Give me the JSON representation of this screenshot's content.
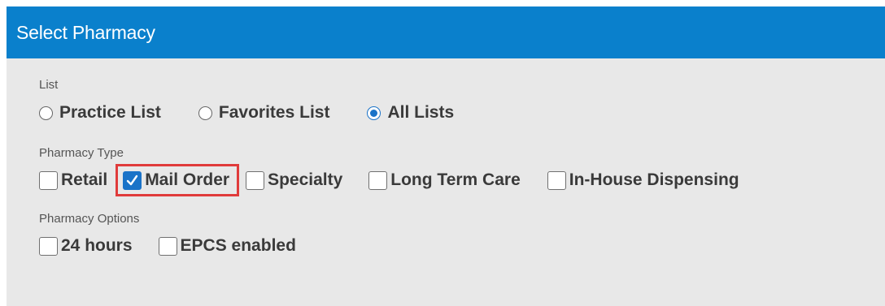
{
  "dialog": {
    "title": "Select Pharmacy"
  },
  "list": {
    "label": "List",
    "options": [
      {
        "label": "Practice List",
        "checked": false
      },
      {
        "label": "Favorites List",
        "checked": false
      },
      {
        "label": "All Lists",
        "checked": true
      }
    ]
  },
  "pharmacy_type": {
    "label": "Pharmacy Type",
    "options": [
      {
        "label": "Retail",
        "checked": false
      },
      {
        "label": "Mail Order",
        "checked": true,
        "highlighted": true
      },
      {
        "label": "Specialty",
        "checked": false
      },
      {
        "label": "Long Term Care",
        "checked": false
      },
      {
        "label": "In-House Dispensing",
        "checked": false
      }
    ]
  },
  "pharmacy_options": {
    "label": "Pharmacy Options",
    "options": [
      {
        "label": "24 hours",
        "checked": false
      },
      {
        "label": "EPCS enabled",
        "checked": false
      }
    ]
  },
  "colors": {
    "header": "#0a80cc",
    "panel": "#e8e8e8",
    "accent": "#1a73c8",
    "highlight_border": "#e03b3b"
  }
}
